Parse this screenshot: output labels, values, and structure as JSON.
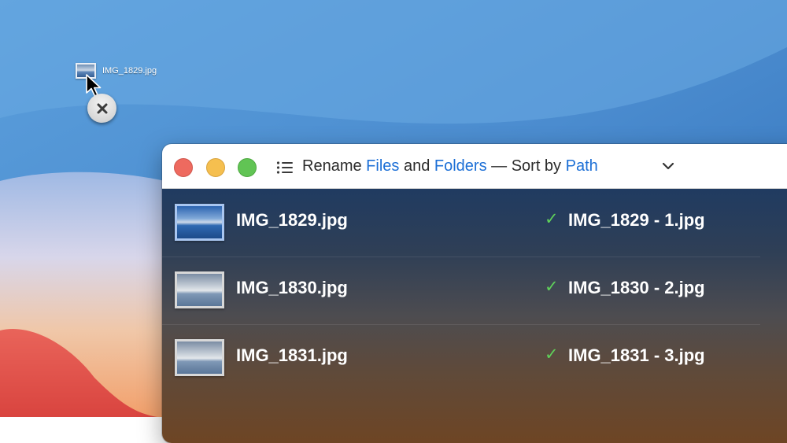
{
  "desktop": {
    "dragged_file": {
      "name": "IMG_1829.jpg",
      "thumb_icon": "image-file-icon"
    },
    "cursor_icon": "arrow-cursor-icon",
    "drag_indicator_icon": "no-drop-x-icon"
  },
  "window": {
    "controls": {
      "close": "close-button",
      "minimize": "minimize-button",
      "maximize": "zoom-button"
    },
    "menu_icon": "list-icon",
    "title": {
      "prefix": "Rename ",
      "files": "Files",
      "and": " and ",
      "folders": "Folders",
      "sort_prefix": " — Sort by ",
      "sort_field": "Path"
    },
    "dropdown_icon": "chevron-down-icon"
  },
  "rows": [
    {
      "original": "IMG_1829.jpg",
      "status_icon": "✓",
      "renamed": "IMG_1829 - 1.jpg",
      "selected": true
    },
    {
      "original": "IMG_1830.jpg",
      "status_icon": "✓",
      "renamed": "IMG_1830 - 2.jpg",
      "selected": false
    },
    {
      "original": "IMG_1831.jpg",
      "status_icon": "✓",
      "renamed": "IMG_1831 - 3.jpg",
      "selected": false
    }
  ],
  "colors": {
    "accent_link": "#1c6fd6",
    "check_green": "#5fd05a",
    "close_red": "#ee6a5f",
    "minimize_yellow": "#f5bf4f",
    "zoom_green": "#61c454"
  }
}
